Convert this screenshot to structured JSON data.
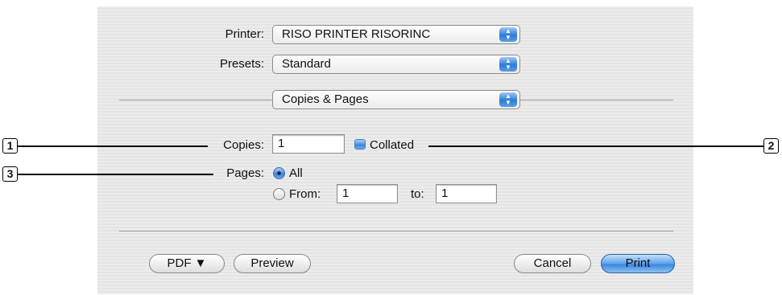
{
  "dialog": {
    "printer_label": "Printer:",
    "printer_value": "RISO PRINTER RISORINC",
    "presets_label": "Presets:",
    "presets_value": "Standard",
    "section_value": "Copies & Pages",
    "copies_label": "Copies:",
    "copies_value": "1",
    "collated_label": "Collated",
    "collated_checked": true,
    "pages_label": "Pages:",
    "pages_all_label": "All",
    "pages_from_label": "From:",
    "pages_from_value": "1",
    "pages_to_label": "to:",
    "pages_to_value": "1",
    "pages_selected": "All"
  },
  "buttons": {
    "pdf_label": "PDF ▼",
    "preview_label": "Preview",
    "cancel_label": "Cancel",
    "print_label": "Print"
  },
  "callouts": {
    "c1": "1",
    "c2": "2",
    "c3": "3"
  },
  "icons": {
    "popup_arrows": "up-down-arrows-icon",
    "pdf_menu": "chevron-down-icon"
  },
  "colors": {
    "accent": "#3f86da",
    "panel_bg": "#e9e9e9"
  }
}
